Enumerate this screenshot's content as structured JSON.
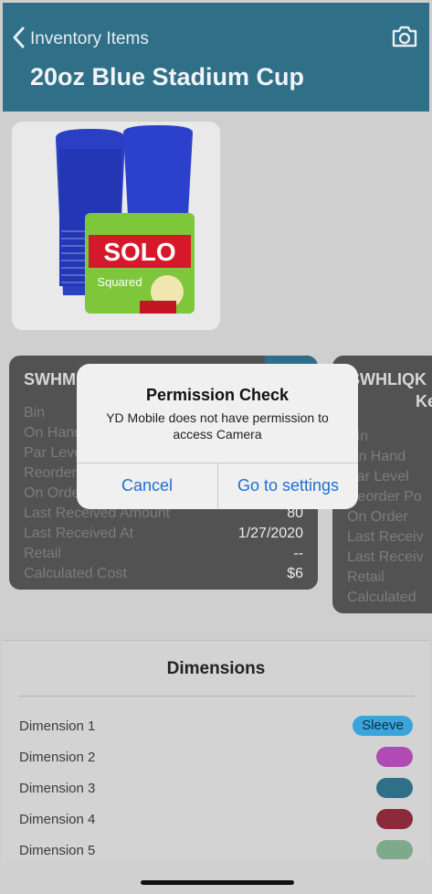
{
  "header": {
    "back_label": "Inventory Items",
    "title": "20oz Blue Stadium Cup",
    "camera_icon": "camera-icon",
    "background": "#2f6f88"
  },
  "product_image": {
    "brand_text": "SOLO",
    "tag_text": "Squared"
  },
  "cards": [
    {
      "code": "SWHM",
      "rows": [
        {
          "label": "Bin",
          "value": ""
        },
        {
          "label": "On Hand",
          "value": ""
        },
        {
          "label": "Par Level",
          "value": ""
        },
        {
          "label": "Reorder",
          "value": ""
        },
        {
          "label": "On Order",
          "value": ""
        },
        {
          "label": "Last Received Amount",
          "value": "80"
        },
        {
          "label": "Last Received At",
          "value": "1/27/2020"
        },
        {
          "label": "Retail",
          "value": "--"
        },
        {
          "label": "Calculated Cost",
          "value": "$6"
        }
      ]
    },
    {
      "code": "SWHLIQK",
      "subtitle": "Keg",
      "rows": [
        {
          "label": "Bin",
          "value": ""
        },
        {
          "label": "On Hand",
          "value": ""
        },
        {
          "label": "Par Level",
          "value": ""
        },
        {
          "label": "Reorder Po",
          "value": ""
        },
        {
          "label": "On Order",
          "value": ""
        },
        {
          "label": "Last Receiv",
          "value": ""
        },
        {
          "label": "Last Receiv",
          "value": ""
        },
        {
          "label": "Retail",
          "value": ""
        },
        {
          "label": "Calculated",
          "value": ""
        }
      ]
    }
  ],
  "dimensions": {
    "title": "Dimensions",
    "items": [
      {
        "label": "Dimension 1",
        "tag": "Sleeve",
        "color": "#3aa4dc"
      },
      {
        "label": "Dimension 2",
        "tag": "",
        "color": "#b04ab4"
      },
      {
        "label": "Dimension 3",
        "tag": "",
        "color": "#2f6f88"
      },
      {
        "label": "Dimension 4",
        "tag": "",
        "color": "#8a2a3a"
      },
      {
        "label": "Dimension 5",
        "tag": "",
        "color": "#7eaa8c"
      }
    ]
  },
  "alert": {
    "title": "Permission Check",
    "message": "YD Mobile does not have permission to access Camera",
    "cancel_label": "Cancel",
    "settings_label": "Go to settings",
    "button_color": "#1c6fd6"
  }
}
